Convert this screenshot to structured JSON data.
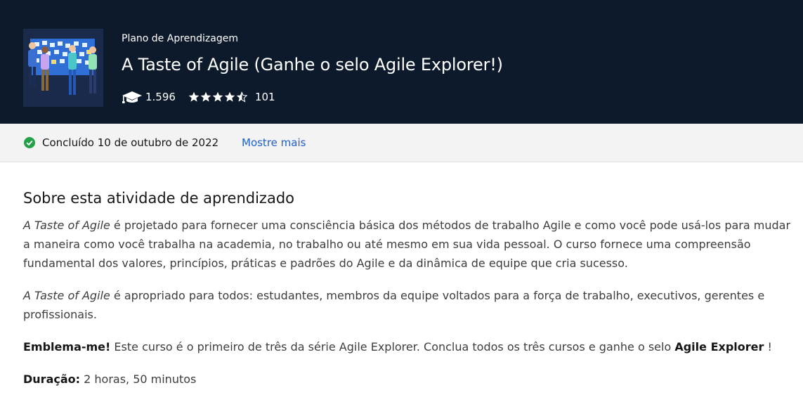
{
  "header": {
    "kicker": "Plano de Aprendizagem",
    "title": "A Taste of Agile (Ganhe o selo Agile Explorer!)",
    "enrollments": "1.596",
    "rating": 4.5,
    "rating_count": "101",
    "thumbnail_icon": "team-board-illustration",
    "enroll_icon": "graduation-cap-icon",
    "star_icon": "star-icon"
  },
  "status": {
    "text": "Concluído 10 de outubro de 2022",
    "more_link": "Mostre mais",
    "icon": "check-circle-icon",
    "icon_color": "#24a148"
  },
  "about": {
    "title": "Sobre esta atividade de aprendizado",
    "p1_italic": "A Taste of Agile",
    "p1_text": " é projetado para fornecer uma consciência básica dos métodos de trabalho Agile e como você pode usá-los para mudar a maneira como você trabalha na academia, no trabalho ou até mesmo em sua vida pessoal. O curso fornece uma compreensão fundamental dos valores, princípios, práticas e padrões do Agile e da dinâmica de equipe que cria sucesso.",
    "p2_italic": "A Taste of Agile",
    "p2_text": " é apropriado para todos: estudantes, membros da equipe voltados para a força de trabalho, executivos, gerentes e profissionais.",
    "p3_bold": "Emblema-me!",
    "p3_text": " Este curso é o primeiro de três da série Agile Explorer. Conclua todos os três cursos e ganhe o selo ",
    "p3_bold2": "Agile Explorer",
    "p3_end": " !",
    "duration_label": "Duração:",
    "duration_value": " 2 horas, 50 minutos"
  },
  "colors": {
    "header_bg": "#0d1a2b",
    "link": "#1f5fcf",
    "status_bg": "#f3f3f3"
  }
}
